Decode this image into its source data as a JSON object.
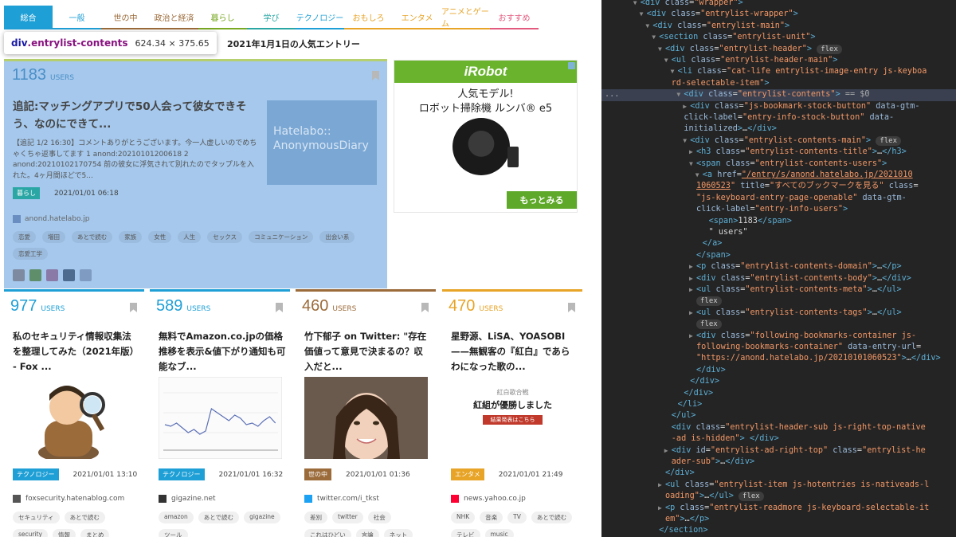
{
  "category_tabs": [
    {
      "label": "総合",
      "color": "#1e9fd6",
      "active": true
    },
    {
      "label": "一般",
      "color": "#1e9fd6",
      "active": false
    },
    {
      "label": "世の中",
      "color": "#9b6b3a",
      "active": false
    },
    {
      "label": "政治と経済",
      "color": "#9b6b3a",
      "active": false
    },
    {
      "label": "暮らし",
      "color": "#79a823",
      "active": false
    },
    {
      "label": "学び",
      "color": "#2aa6a4",
      "active": false
    },
    {
      "label": "テクノロジー",
      "color": "#1e9fd6",
      "active": false
    },
    {
      "label": "おもしろ",
      "color": "#e7a427",
      "active": false
    },
    {
      "label": "エンタメ",
      "color": "#e7a427",
      "active": false
    },
    {
      "label": "アニメとゲーム",
      "color": "#e7a427",
      "active": false
    },
    {
      "label": "おすすめ",
      "color": "#e35a7f",
      "active": false
    }
  ],
  "inspector_tooltip": {
    "element": "div",
    "class": ".entrylist-contents",
    "size": "624.34 × 375.65"
  },
  "section_title": "2021年1月1日の人気エントリー",
  "main_entry": {
    "users": "1183",
    "users_label": "USERS",
    "title": "追記:マッチングアプリで50人会って彼女できそう、なのにできて...",
    "thumb_text": "Hatelabo:: AnonymousDiary",
    "body": "【追記 1/2 16:30】コメントありがとうございます。今一人虚しいのでめちゃくちゃ返事してます 1 anond:20210101200618 2 anond:20210102170754 前の彼女に浮気されて別れたのでタップルを入れた。4ヶ月間ほどで5...",
    "category": "暮らし",
    "category_color": "#79a823",
    "date": "2021/01/01 06:18",
    "domain": "anond.hatelabo.jp",
    "tags": [
      "恋愛",
      "増田",
      "あとで読む",
      "家族",
      "女性",
      "人生",
      "セックス",
      "コミュニケーション",
      "出会い系",
      "恋愛工学"
    ],
    "bookmarker_colors": [
      "#7d8aa0",
      "#5f8e6b",
      "#8a7aa8",
      "#4d6b8f",
      "#7f9bc2"
    ]
  },
  "ad": {
    "brand": "iRobot",
    "headline_1": "人気モデル!",
    "headline_2": "ロボット掃除機 ルンバ® e5",
    "cta": "もっとみる",
    "brand_color": "#6ab42d"
  },
  "cards": [
    {
      "users": "977",
      "users_label": "USERS",
      "color": "#1e9fd6",
      "title": "私のセキュリティ情報収集法を整理してみた（2021年版） - Fox ...",
      "thumb": "illustration",
      "category": "テクノロジー",
      "date": "2021/01/01 13:10",
      "domain": "foxsecurity.hatenablog.com",
      "fav": "#555555",
      "tags": [
        "セキュリティ",
        "あとで読む",
        "security",
        "情報",
        "まとめ"
      ]
    },
    {
      "users": "589",
      "users_label": "USERS",
      "color": "#1e9fd6",
      "title": "無料でAmazon.co.jpの価格推移を表示&値下がり通知も可能なブ...",
      "thumb": "price-chart",
      "category": "テクノロジー",
      "date": "2021/01/01 16:32",
      "domain": "gigazine.net",
      "fav": "#333333",
      "tags": [
        "amazon",
        "あとで読む",
        "gigazine",
        "ツール"
      ]
    },
    {
      "users": "460",
      "users_label": "USERS",
      "color": "#9b6b3a",
      "title": "竹下郁子 on Twitter: \"存在価値って意見で決まるの？収入だと...",
      "thumb": "portrait",
      "category": "世の中",
      "date": "2021/01/01 01:36",
      "domain": "twitter.com/i_tkst",
      "fav": "#1da1f2",
      "tags": [
        "差別",
        "twitter",
        "社会",
        "これはひどい",
        "言論",
        "ネット"
      ]
    },
    {
      "users": "470",
      "users_label": "USERS",
      "color": "#e7a427",
      "title": "星野源、LiSA、YOASOBI——無観客の『紅白』であらわになった歌の...",
      "thumb": "article",
      "category": "エンタメ",
      "date": "2021/01/01 21:49",
      "domain": "news.yahoo.co.jp",
      "fav": "#ff0033",
      "tags": [
        "NHK",
        "音楽",
        "TV",
        "あとで読む",
        "テレビ",
        "music"
      ]
    }
  ],
  "thumb_texts": {
    "article_1": "紅白歌合戦",
    "article_2": "紅組が優勝しました",
    "article_3": "結果発表はこちら"
  },
  "devtools_lines": [
    {
      "indent": 6,
      "tw": "▼",
      "html": "<span class='tagc'>&lt;div</span> <span class='attr'>class</span>=<span class='aval'>\"wrapper\"</span><span class='tagc'>&gt;</span>"
    },
    {
      "indent": 7,
      "tw": "▼",
      "html": "<span class='tagc'>&lt;div</span> <span class='attr'>class</span>=<span class='aval'>\"entrylist-wrapper\"</span><span class='tagc'>&gt;</span>"
    },
    {
      "indent": 8,
      "tw": "▼",
      "html": "<span class='tagc'>&lt;div</span> <span class='attr'>class</span>=<span class='aval'>\"entrylist-main\"</span><span class='tagc'>&gt;</span>"
    },
    {
      "indent": 9,
      "tw": "▼",
      "html": "<span class='tagc'>&lt;section</span> <span class='attr'>class</span>=<span class='aval'>\"entrylist-unit\"</span><span class='tagc'>&gt;</span>"
    }
  ]
}
